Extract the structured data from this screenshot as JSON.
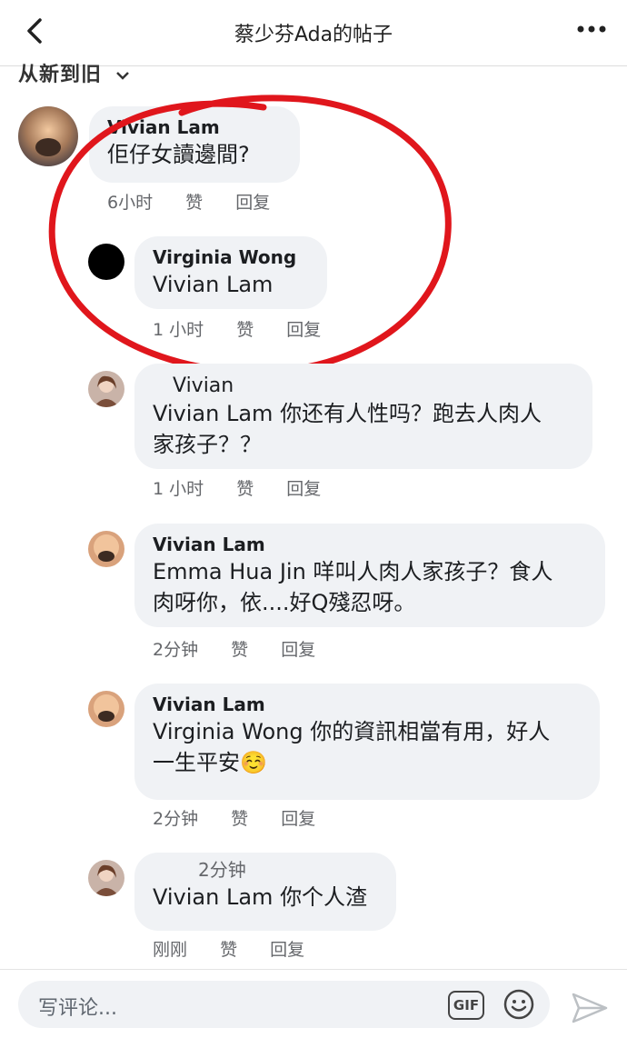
{
  "header": {
    "title": "蔡少芬Ada的帖子",
    "sort_label": "从新到旧"
  },
  "comments": [
    {
      "name": "Vivian Lam",
      "text": "佢仔女讀邊間?",
      "time": "6小时",
      "like": "赞",
      "reply": "回复"
    },
    {
      "name": "Virginia Wong",
      "text": "Vivian Lam",
      "time": "1 小时",
      "like": "赞",
      "reply": "回复"
    },
    {
      "name": "Vivian",
      "text_line1": "Vivian Lam 你还有人性吗？跑去人肉人",
      "text_line2": "家孩子？？",
      "time": "1 小时",
      "like": "赞",
      "reply": "回复"
    },
    {
      "name": "Vivian Lam",
      "text_line1": "Emma Hua Jin 咩叫人肉人家孩子？食人",
      "text_line2": "肉呀你，依....好Q殘忍呀。",
      "time": "2分钟",
      "like": "赞",
      "reply": "回复"
    },
    {
      "name": "Vivian Lam",
      "text_line1": "Virginia Wong 你的資訊相當有用，好人",
      "text_line2": "一生平安☺️",
      "time": "2分钟",
      "like": "赞",
      "reply": "回复"
    },
    {
      "name": "2分钟",
      "text": "Vivian Lam 你个人渣",
      "time": "刚刚",
      "like": "赞",
      "reply": "回复"
    }
  ],
  "composer": {
    "placeholder": "写评论...",
    "gif_label": "GIF"
  },
  "icons": [
    "back-arrow-icon",
    "more-dots-icon",
    "chevron-down-icon",
    "emoji-icon",
    "send-icon"
  ],
  "colors": {
    "bubble": "#f0f2f5",
    "annotation_red": "#e0161c",
    "meta_text": "#65676b"
  }
}
